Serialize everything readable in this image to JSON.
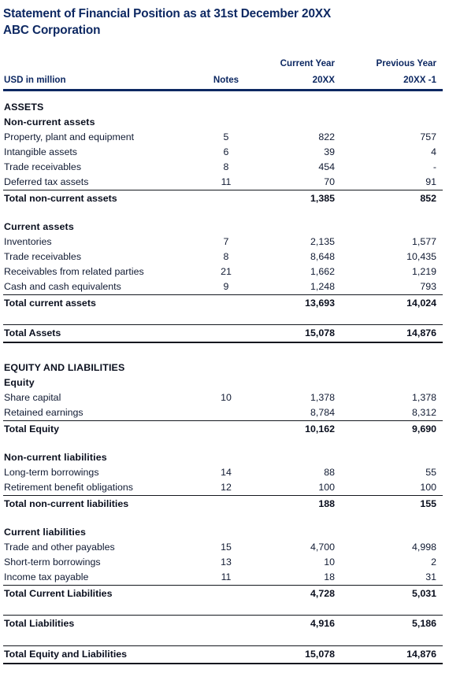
{
  "document": {
    "title": "Statement of Financial Position as at 31st December 20XX",
    "subtitle": "ABC Corporation",
    "accent_color": "#0d2862",
    "text_color": "#111b33",
    "background_color": "#ffffff"
  },
  "columns": {
    "label": "USD in million",
    "notes": "Notes",
    "current_year_top": "Current Year",
    "current_year_bottom": "20XX",
    "previous_year_top": "Previous Year",
    "previous_year_bottom": "20XX -1"
  },
  "sections": {
    "assets_heading": "ASSETS",
    "non_current_assets_heading": "Non-current assets",
    "current_assets_heading": "Current assets",
    "equity_liabilities_heading": "EQUITY AND LIABILITIES",
    "equity_heading": "Equity",
    "non_current_liabilities_heading": "Non-current liabilities",
    "current_liabilities_heading": "Current liabilities"
  },
  "rows": {
    "ppe": {
      "label": "Property, plant and equipment",
      "notes": "5",
      "current": "822",
      "previous": "757"
    },
    "intangibles": {
      "label": "Intangible assets",
      "notes": "6",
      "current": "39",
      "previous": "4"
    },
    "trade_rec_nc": {
      "label": "Trade receivables",
      "notes": "8",
      "current": "454",
      "previous": "-"
    },
    "deferred_tax": {
      "label": "Deferred tax assets",
      "notes": "11",
      "current": "70",
      "previous": "91"
    },
    "total_nca": {
      "label": "Total non-current assets",
      "notes": "",
      "current": "1,385",
      "previous": "852"
    },
    "inventories": {
      "label": "Inventories",
      "notes": "7",
      "current": "2,135",
      "previous": "1,577"
    },
    "trade_rec_c": {
      "label": "Trade receivables",
      "notes": "8",
      "current": "8,648",
      "previous": "10,435"
    },
    "rec_related": {
      "label": "Receivables from related parties",
      "notes": "21",
      "current": "1,662",
      "previous": "1,219"
    },
    "cash": {
      "label": "Cash and cash equivalents",
      "notes": "9",
      "current": "1,248",
      "previous": "793"
    },
    "total_ca": {
      "label": "Total current assets",
      "notes": "",
      "current": "13,693",
      "previous": "14,024"
    },
    "total_assets": {
      "label": "Total Assets",
      "notes": "",
      "current": "15,078",
      "previous": "14,876"
    },
    "share_capital": {
      "label": "Share capital",
      "notes": "10",
      "current": "1,378",
      "previous": "1,378"
    },
    "retained": {
      "label": "Retained earnings",
      "notes": "",
      "current": "8,784",
      "previous": "8,312"
    },
    "total_equity": {
      "label": "Total Equity",
      "notes": "",
      "current": "10,162",
      "previous": "9,690"
    },
    "lt_borrowings": {
      "label": "Long-term borrowings",
      "notes": "14",
      "current": "88",
      "previous": "55"
    },
    "retirement": {
      "label": "Retirement benefit obligations",
      "notes": "12",
      "current": "100",
      "previous": "100"
    },
    "total_ncl": {
      "label": "Total non-current liabilities",
      "notes": "",
      "current": "188",
      "previous": "155"
    },
    "trade_pay": {
      "label": "Trade and other payables",
      "notes": "15",
      "current": "4,700",
      "previous": "4,998"
    },
    "st_borrowings": {
      "label": "Short-term borrowings",
      "notes": "13",
      "current": "10",
      "previous": "2"
    },
    "income_tax": {
      "label": "Income tax payable",
      "notes": "11",
      "current": "18",
      "previous": "31"
    },
    "total_cl": {
      "label": "Total Current Liabilities",
      "notes": "",
      "current": "4,728",
      "previous": "5,031"
    },
    "total_liab": {
      "label": "Total Liabilities",
      "notes": "",
      "current": "4,916",
      "previous": "5,186"
    },
    "total_eq_liab": {
      "label": "Total Equity and Liabilities",
      "notes": "",
      "current": "15,078",
      "previous": "14,876"
    }
  }
}
